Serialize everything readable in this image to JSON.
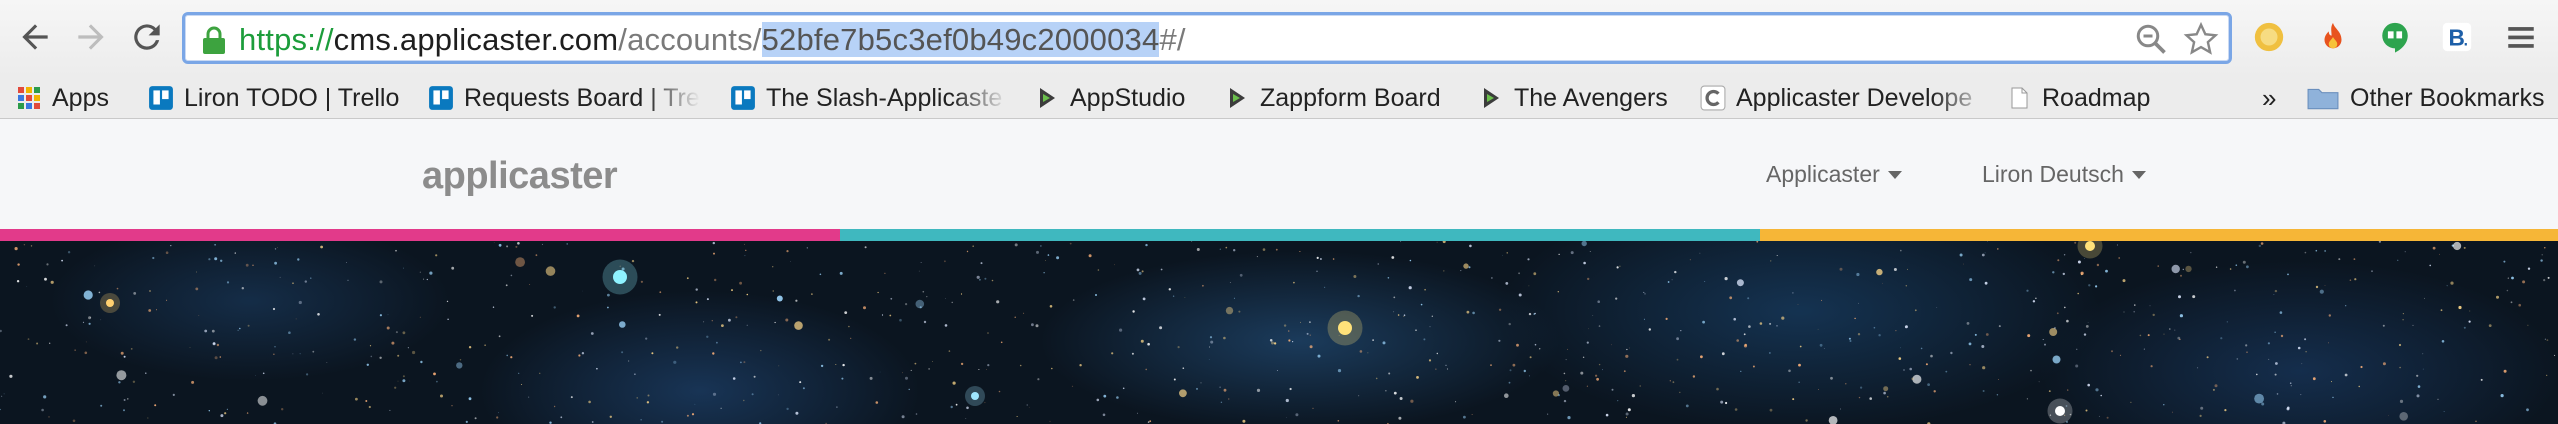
{
  "browser": {
    "url": {
      "scheme": "https://",
      "host": "cms.applicaster.com",
      "path_prefix": "/accounts/",
      "selected": "52bfe7b5c3ef0b49c2000034",
      "suffix": "#/"
    },
    "bookmarks": [
      {
        "label": "Apps",
        "icon": "apps-grid-icon"
      },
      {
        "label": "Liron TODO | Trello",
        "icon": "trello-icon"
      },
      {
        "label": "Requests Board | Tre",
        "icon": "trello-icon"
      },
      {
        "label": "The Slash-Applicaste",
        "icon": "trello-icon"
      },
      {
        "label": "AppStudio",
        "icon": "zapp-icon"
      },
      {
        "label": "Zappform Board",
        "icon": "zapp-icon"
      },
      {
        "label": "The Avengers",
        "icon": "zapp-icon"
      },
      {
        "label": "Applicaster Develope",
        "icon": "applicaster-icon"
      },
      {
        "label": "Roadmap",
        "icon": "page-icon"
      }
    ],
    "other_bookmarks": "Other Bookmarks",
    "overflow": "»"
  },
  "site": {
    "logo": "applicaster",
    "account_menu": "Applicaster",
    "user_menu": "Liron Deutsch"
  },
  "colors": {
    "stripe_pink": "#e23a8a",
    "stripe_teal": "#3fb8bf",
    "stripe_yellow": "#f6b637"
  }
}
